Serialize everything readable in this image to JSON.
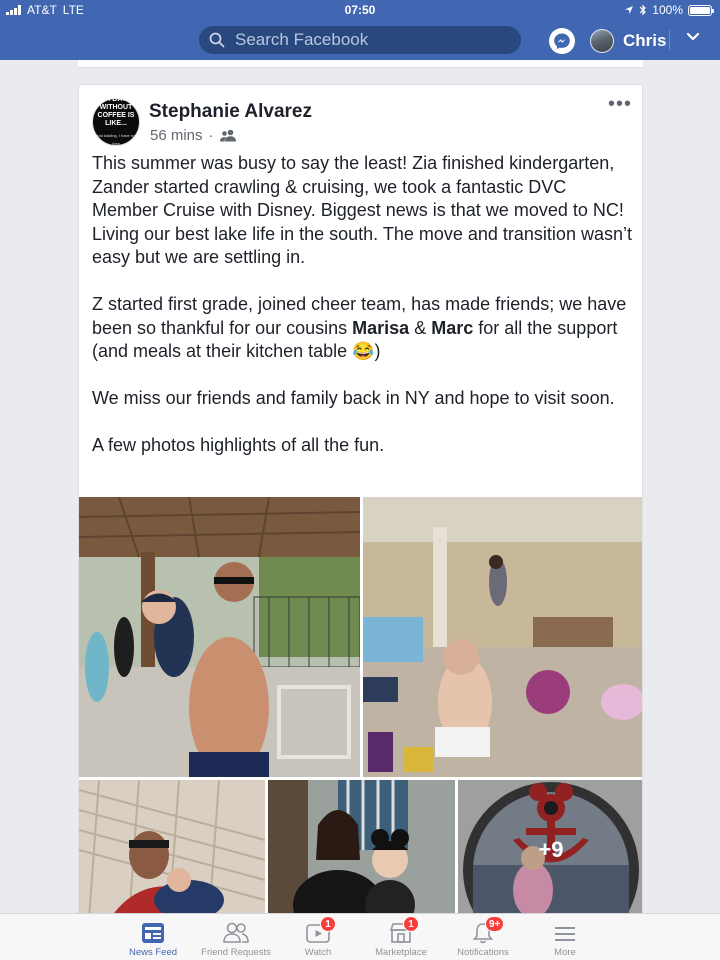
{
  "status_bar": {
    "carrier": "AT&T",
    "network": "LTE",
    "time": "07:50",
    "battery": "100%"
  },
  "header": {
    "search_placeholder": "Search Facebook",
    "profile_name": "Chris",
    "color": "#4267b2"
  },
  "post": {
    "author": "Stephanie Alvarez",
    "avatar_text_line1": "A DAY WITHOUT",
    "avatar_text_line2": "COFFEE IS LIKE...",
    "avatar_text_line3": "just kidding, I have no idea",
    "time": "56 mins",
    "separator": "·",
    "audience_icon": "friends-icon",
    "paragraphs": [
      {
        "text": "This summer was busy to say the least! Zia finished kindergarten, Zander started crawling & cruising, we took a fantastic DVC Member Cruise with Disney.  Biggest news is that we moved to NC! Living our best lake life in the south. The move and transition wasn’t easy but we are settling in."
      },
      {
        "pre": "Z started first grade, joined cheer team, has made friends; we have been so thankful for our cousins ",
        "bold1": "Marisa",
        "mid": " & ",
        "bold2": "Marc",
        "post": " for all the support (and meals at their kitchen table 😂)"
      },
      {
        "text": "We miss our friends and family back in NY and hope to visit soon."
      },
      {
        "text": "A few photos highlights of all the fun."
      }
    ],
    "more_photos": "+9"
  },
  "tabbar": {
    "tabs": [
      {
        "label": "News Feed",
        "icon": "news-feed-icon",
        "active": true
      },
      {
        "label": "Friend Requests",
        "icon": "friend-requests-icon"
      },
      {
        "label": "Watch",
        "icon": "watch-icon",
        "badge": "1"
      },
      {
        "label": "Marketplace",
        "icon": "marketplace-icon",
        "badge": "1"
      },
      {
        "label": "Notifications",
        "icon": "notifications-icon",
        "badge": "9+"
      },
      {
        "label": "More",
        "icon": "menu-icon"
      }
    ]
  }
}
